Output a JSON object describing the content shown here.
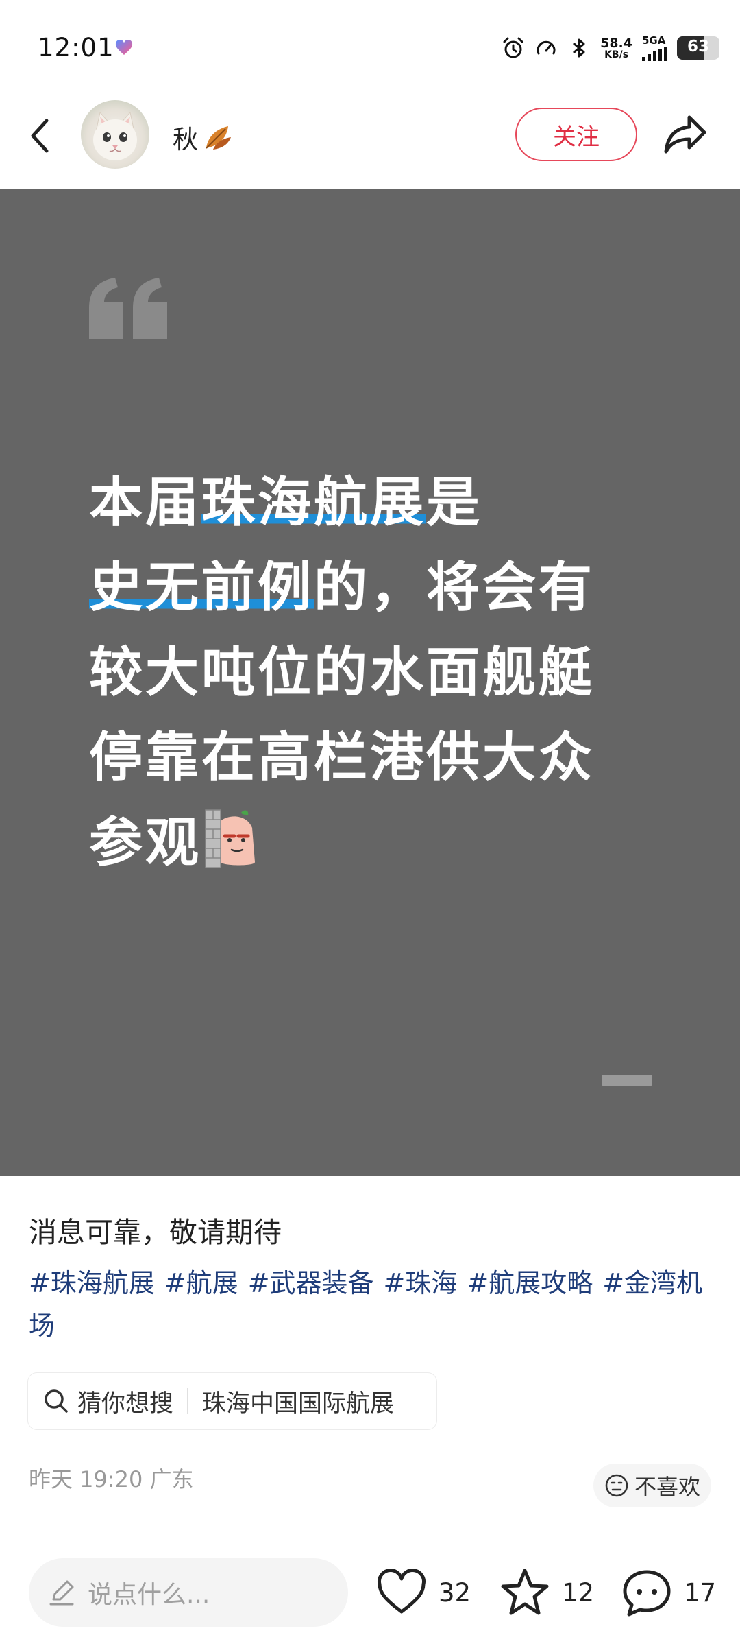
{
  "status": {
    "time": "12:01",
    "net_speed": "58.4",
    "net_unit": "KB/s",
    "network": "5GA",
    "battery": "63",
    "battery_fraction": 0.63
  },
  "header": {
    "username": "秋",
    "follow_label": "关注"
  },
  "card": {
    "lines": [
      [
        {
          "t": "本届"
        },
        {
          "t": "珠海航展",
          "hl": true
        },
        {
          "t": "是"
        }
      ],
      [
        {
          "t": "史无前例",
          "hl": true
        },
        {
          "t": "的，将会有"
        }
      ],
      [
        {
          "t": "较大吨位的水面舰艇"
        }
      ],
      [
        {
          "t": "停靠在高栏港供大众"
        }
      ],
      [
        {
          "t": "参观"
        }
      ]
    ],
    "highlight_color": "#1f8fd8",
    "background": "#656565"
  },
  "post": {
    "caption": "消息可靠，敬请期待",
    "tags": [
      "#珠海航展",
      "#航展",
      "#武器装备",
      "#珠海",
      "#航展攻略",
      "#金湾机场"
    ],
    "search_label": "猜你想搜",
    "search_keyword": "珠海中国国际航展",
    "meta": "昨天 19:20 广东",
    "dislike_label": "不喜欢"
  },
  "bottom": {
    "comment_placeholder": "说点什么...",
    "likes": "32",
    "favorites": "12",
    "comments": "17"
  },
  "colors": {
    "accent": "#e02e44",
    "tag": "#1f3d7a"
  }
}
